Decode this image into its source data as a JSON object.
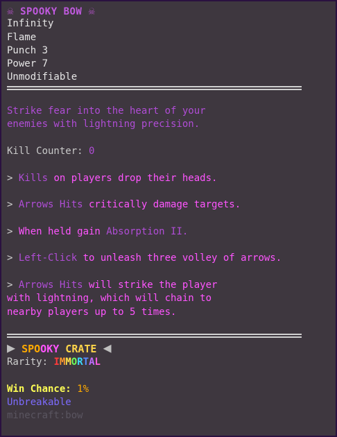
{
  "header": {
    "skull_left": "☠",
    "title": "SPOOKY BOW",
    "skull_right": "☠"
  },
  "enchantments": [
    "Infinity",
    "Flame",
    "Punch 3",
    "Power 7",
    "Unmodifiable"
  ],
  "description": {
    "line1": "Strike fear into the heart of your",
    "line2": "enemies with lightning precision."
  },
  "kill_counter": {
    "label": "Kill Counter: ",
    "value": "0"
  },
  "abilities": [
    {
      "bullet": "> ",
      "highlight": "Kills",
      "text": " on players drop their heads."
    },
    {
      "bullet": "> ",
      "highlight": "Arrows Hits",
      "text": " critically damage targets."
    },
    {
      "bullet": "> ",
      "text": "When held gain ",
      "highlight": "Absorption II."
    },
    {
      "bullet": "> ",
      "highlight": "Left-Click",
      "text": " to unleash three volley of arrows."
    }
  ],
  "last_ability": {
    "bullet": "> ",
    "highlight": "Arrows Hits",
    "line1": " will strike the player",
    "line2": "with lightning, which will chain to",
    "line3": "nearby players up to 5 times."
  },
  "crate": {
    "arrow_left": "▶",
    "word1_a": "SPO",
    "word1_b": "OKY",
    "space": " ",
    "word2": "CRATE",
    "arrow_right": "◀"
  },
  "rarity": {
    "label": "Rarity: ",
    "letters": [
      "I",
      "M",
      "M",
      "O",
      "R",
      "T",
      "A",
      "L"
    ],
    "colors": [
      "#ff3b3b",
      "#ff9a2e",
      "#ffe14a",
      "#6dff5b",
      "#3bd8ff",
      "#5b8cff",
      "#c06bff",
      "#ff5be0"
    ]
  },
  "win_chance": {
    "label": "Win Chance: ",
    "value": "1%"
  },
  "unbreakable": "Unbreakable",
  "item_id": "minecraft:bow"
}
